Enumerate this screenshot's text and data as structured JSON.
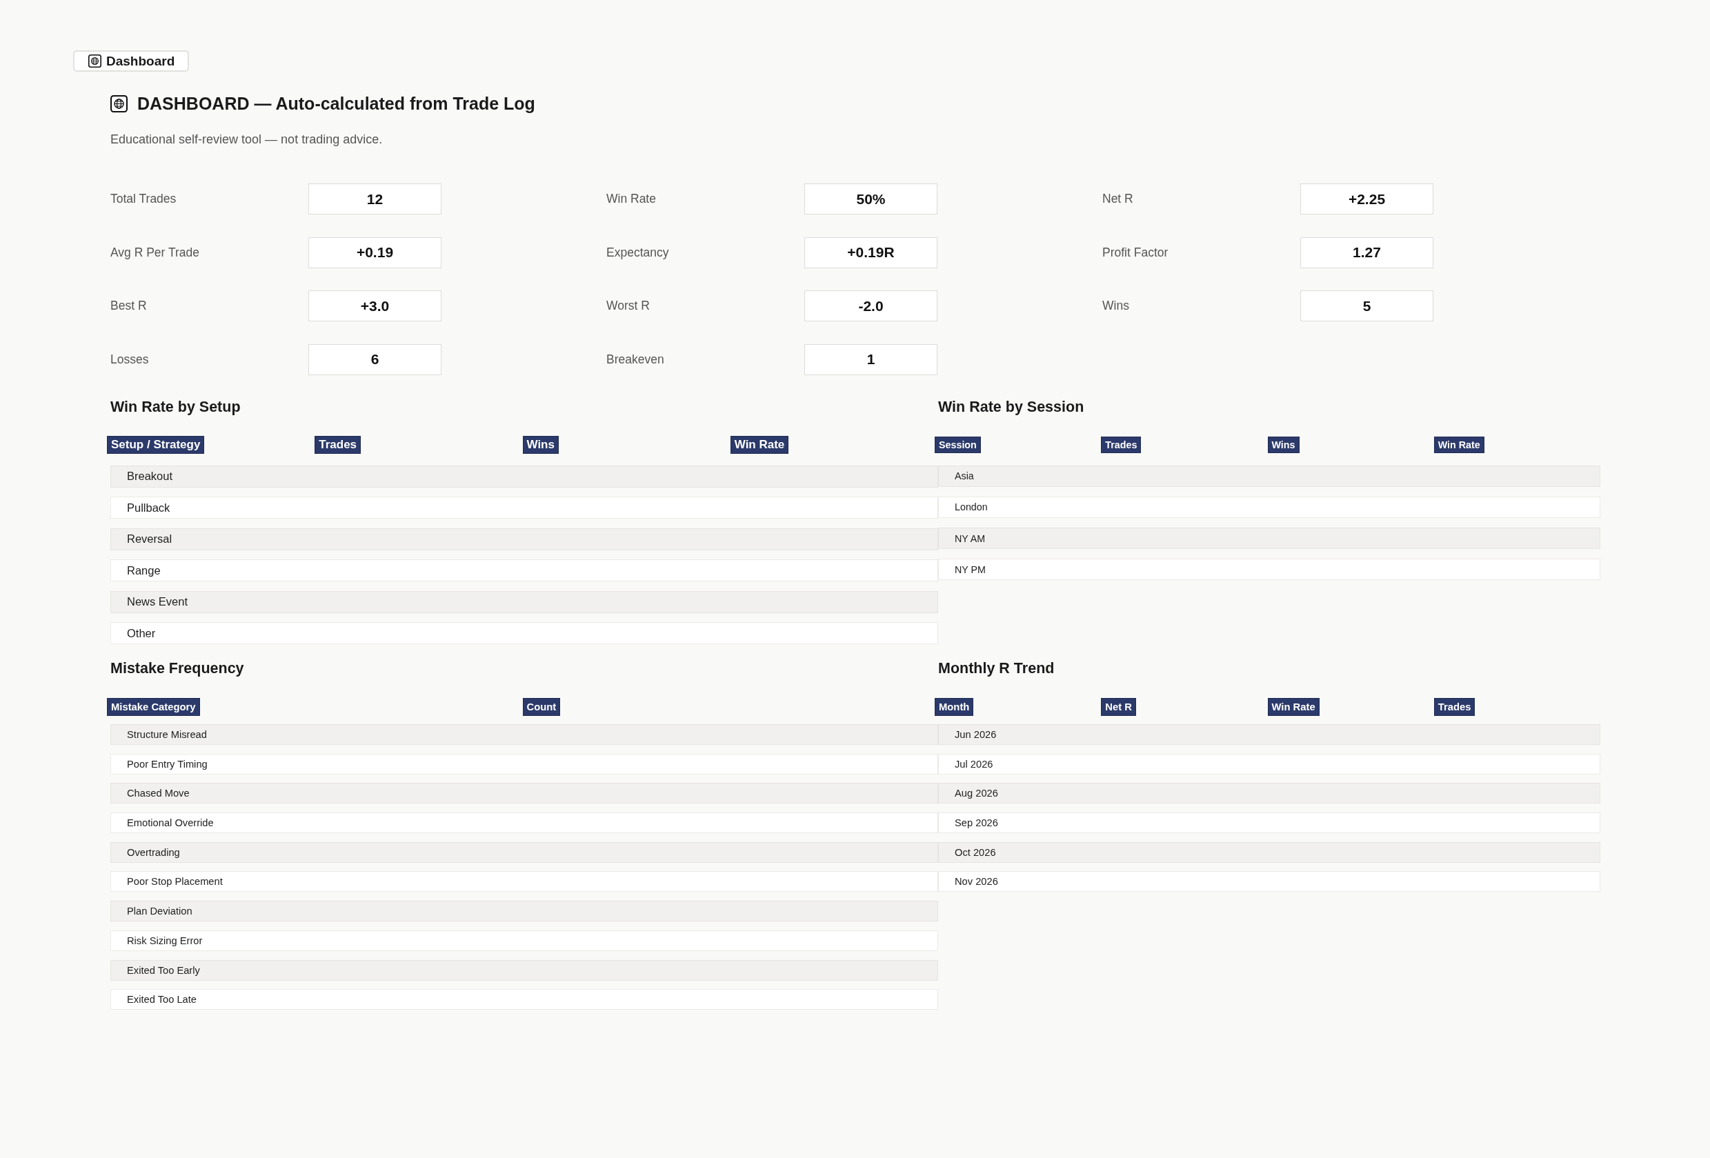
{
  "tab": {
    "label": "Dashboard"
  },
  "header": {
    "title": "DASHBOARD — Auto-calculated from Trade Log",
    "subtitle": "Educational self-review tool — not trading advice."
  },
  "stats": [
    {
      "label": "Total Trades",
      "value": "12"
    },
    {
      "label": "Win Rate",
      "value": "50%"
    },
    {
      "label": "Net R",
      "value": "+2.25"
    },
    {
      "label": "Avg R Per Trade",
      "value": "+0.19"
    },
    {
      "label": "Expectancy",
      "value": "+0.19R"
    },
    {
      "label": "Profit Factor",
      "value": "1.27"
    },
    {
      "label": "Best R",
      "value": "+3.0"
    },
    {
      "label": "Worst R",
      "value": "-2.0"
    },
    {
      "label": "Wins",
      "value": "5"
    },
    {
      "label": "Losses",
      "value": "6"
    },
    {
      "label": "Breakeven",
      "value": "1"
    }
  ],
  "win_rate_by_setup": {
    "title": "Win Rate by Setup",
    "columns": [
      "Setup / Strategy",
      "Trades",
      "Wins",
      "Win Rate"
    ],
    "rows": [
      "Breakout",
      "Pullback",
      "Reversal",
      "Range",
      "News Event",
      "Other"
    ]
  },
  "win_rate_by_session": {
    "title": "Win Rate by Session",
    "columns": [
      "Session",
      "Trades",
      "Wins",
      "Win Rate"
    ],
    "rows": [
      "Asia",
      "London",
      "NY AM",
      "NY PM"
    ]
  },
  "mistake_frequency": {
    "title": "Mistake Frequency",
    "columns": [
      "Mistake Category",
      "Count"
    ],
    "rows": [
      "Structure Misread",
      "Poor Entry Timing",
      "Chased Move",
      "Emotional Override",
      "Overtrading",
      "Poor Stop Placement",
      "Plan Deviation",
      "Risk Sizing Error",
      "Exited Too Early",
      "Exited Too Late"
    ]
  },
  "monthly_r_trend": {
    "title": "Monthly R Trend",
    "columns": [
      "Month",
      "Net R",
      "Win Rate",
      "Trades"
    ],
    "rows": [
      "Jun 2026",
      "Jul 2026",
      "Aug 2026",
      "Sep 2026",
      "Oct 2026",
      "Nov 2026"
    ]
  }
}
